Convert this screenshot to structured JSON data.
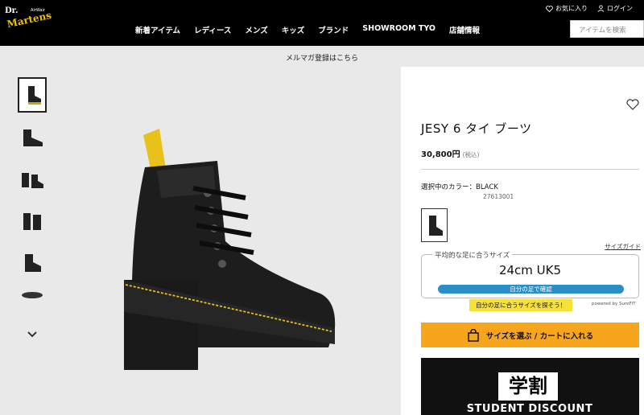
{
  "header": {
    "logo_text_top": "Dr.",
    "logo_text_main": "Martens",
    "logo_text_small": "AirWair",
    "nav": [
      "新着アイテム",
      "レディース",
      "メンズ",
      "キッズ",
      "ブランド",
      "SHOWROOM TYO",
      "店舗情報"
    ],
    "favorites_label": "お気に入り",
    "login_label": "ログイン",
    "search_placeholder": "アイテムを検索"
  },
  "banner": {
    "text": "メルマガ登録はこちら"
  },
  "product": {
    "title": "JESY 6 タイ ブーツ",
    "price": "30,800円",
    "tax_note": "(税込)",
    "color_label": "選択中のカラー：BLACK",
    "product_code": "27613001",
    "size_guide": "サイズガイド",
    "fit_label": "平均的な足に合うサイズ",
    "fit_size": "24cm UK5",
    "fit_button": "自分の足で確認",
    "fit_tip": "自分の足に合うサイズを探そう！",
    "powered_by": "powered by SureFIT",
    "cart_label": "サイズを選ぶ / カートに入れる"
  },
  "promo": {
    "kanji": "学割",
    "text": "STUDENT DISCOUNT"
  },
  "colors": {
    "header_bg": "#000000",
    "cart_bg": "#f7a51d",
    "fit_bar": "#2a8fc6",
    "tip_bg": "#f5e13a",
    "accent_yellow": "#e8c21a"
  }
}
